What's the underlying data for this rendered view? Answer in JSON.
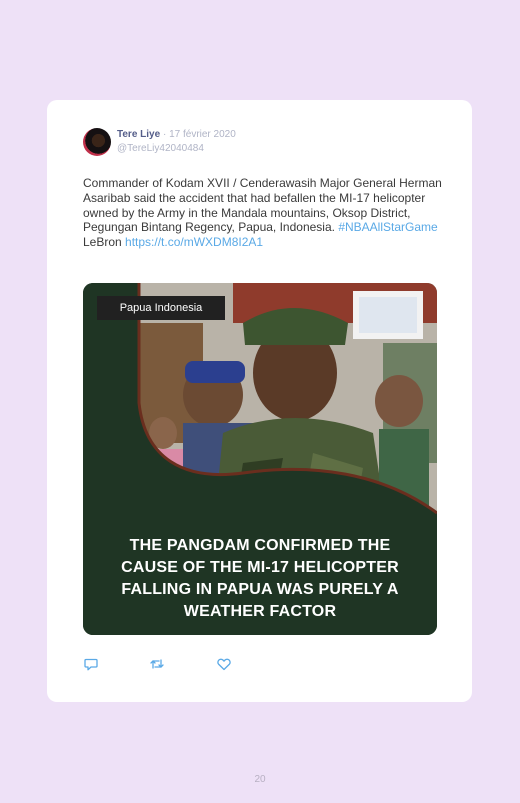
{
  "tweet": {
    "author_name": "Tere Liye",
    "separator": "·",
    "date": "17 février 2020",
    "handle": "@TereLiy42040484",
    "text": "Commander of Kodam XVII / Cenderawasih Major General Herman Asaribab said the accident that had befallen the MI-17 helicopter owned by the Army in the Mandala mountains, Oksop District, Pegungan Bintang Regency, Papua, Indonesia. ",
    "hashtag": "#NBAAllStarGame",
    "after_hashtag": " LeBron ",
    "link": "https://t.co/mWXDM8I2A1",
    "media": {
      "tag": "Papua Indonesia",
      "headline": "THE PANGDAM CONFIRMED THE CAUSE OF THE MI-17 HELICOPTER FALLING IN PAPUA WAS PURELY A WEATHER FACTOR"
    },
    "actions": [
      {
        "icon": "reply-icon"
      },
      {
        "icon": "retweet-icon"
      },
      {
        "icon": "like-icon"
      }
    ]
  },
  "colors": {
    "page_background": "#eee1f7",
    "card_background": "#ffffff",
    "link": "#5aa9e6",
    "media_panel": "#1f3524"
  },
  "page_number": "20"
}
